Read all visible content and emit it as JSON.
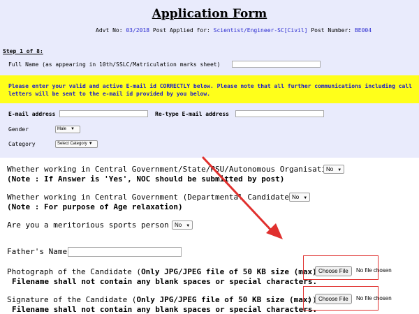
{
  "form": {
    "title": "Application Form",
    "advt_label": "Advt No:",
    "advt_no": "03/2018",
    "post_applied_label": "Post Applied for:",
    "post_applied": "Scientist/Engineer-SC[Civil]",
    "post_number_label": "Post Number:",
    "post_number": "BE004",
    "step": "Step 1 of 8:"
  },
  "fields_top": {
    "full_name_label": "Full Name (as appearing in 10th/SSLC/Matriculation marks sheet)",
    "notice_line1": "Please enter your valid and active E-mail id CORRECTLY below. Please note that all further communications including call",
    "notice_line2": "letters will be sent to the e-mail id provided by you below.",
    "email_label": "E-mail address",
    "retype_email_label": "Re-type E-mail address",
    "gender_label": "Gender",
    "gender_value": "Male",
    "category_label": "Category",
    "category_value": "Select Category"
  },
  "fields_bottom": {
    "central_govt_label": "Whether working in Central Government/State/PSU/Autonomous Organisation",
    "central_govt_value": "No",
    "central_govt_note": "(Note : If Answer is 'Yes', NOC should be submitted by post)",
    "departmental_label": "Whether working in Central Government (Departmental Candidate)",
    "departmental_value": "No",
    "departmental_note": "(Note : For purpose of Age relaxation)",
    "sports_label": "Are you a meritorious sports person",
    "sports_value": "No",
    "father_label": "Father's Name",
    "photo_label": "Photograph of the Candidate (",
    "photo_hint": "Only JPG/JPEG file of 50 KB size (max)",
    "photo_close": ")",
    "filename_note": "Filename shall not contain any blank spaces or special characters.",
    "signature_label": "Signature of the Candidate (",
    "signature_hint": "Only JPG/JPEG file of 50 KB size (max)",
    "signature_close": ")",
    "colon": ":",
    "choose_file": "Choose File",
    "no_file": "No file chosen"
  },
  "colors": {
    "top_background": "#e9ebfc",
    "notice_background": "#ffff1a",
    "notice_text": "#1d1dc8",
    "highlight": "#e0302e"
  },
  "icons": {
    "dropdown": "chevron-down-icon",
    "annotation": "red-arrow"
  }
}
